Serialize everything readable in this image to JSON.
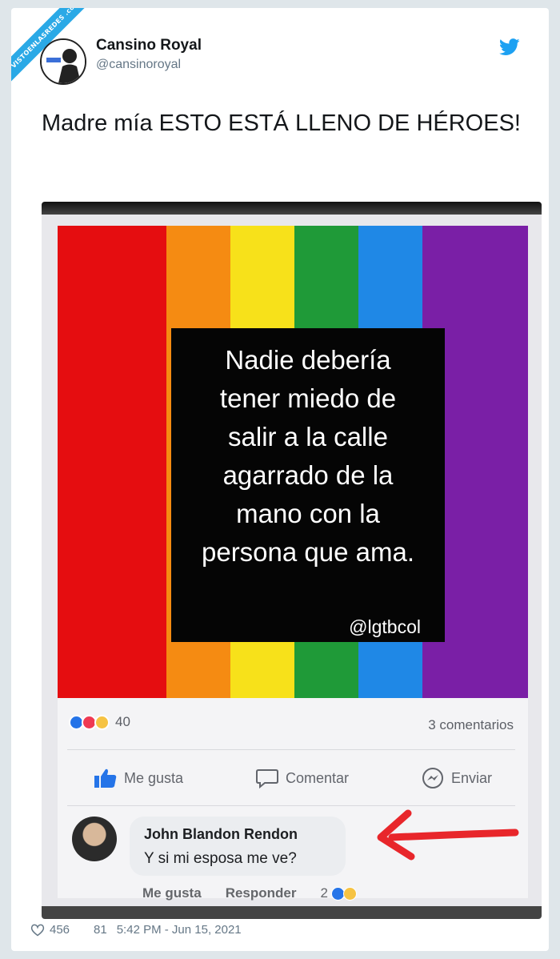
{
  "watermark": {
    "text": "VISTOENLASREDES .com"
  },
  "tweet": {
    "author_name": "Cansino Royal",
    "author_handle": "@cansinoroyal",
    "text": "Madre mía ESTO ESTÁ LLENO DE HÉROES!",
    "likes": "456",
    "retweets": "81",
    "timestamp": "5:42 PM - Jun 15, 2021"
  },
  "media": {
    "quote_lines": [
      "Nadie debería",
      "tener miedo de",
      "salir a la calle",
      "agarrado de la",
      "mano con la",
      "persona que ama."
    ],
    "quote_handle": "@lgtbcol",
    "reaction_count": "40",
    "comments_count": "3 comentarios",
    "actions": {
      "like": "Me gusta",
      "comment": "Comentar",
      "send": "Enviar"
    },
    "comment": {
      "name": "John Blandon Rendon",
      "text": "Y si mi esposa me ve?",
      "like_label": "Me gusta",
      "reply_label": "Responder",
      "reaction_count": "2"
    }
  },
  "colors": {
    "twitter_blue": "#1da1f2",
    "flag": [
      "#e50d10",
      "#f58b12",
      "#f7e11a",
      "#1f9a38",
      "#1f88e6",
      "#7a1fa6"
    ],
    "arrow_red": "#e8262b"
  },
  "icons": [
    "twitter-bird-icon",
    "thumbs-up-icon",
    "speech-bubble-icon",
    "messenger-icon",
    "heart-icon",
    "retweet-icon"
  ]
}
